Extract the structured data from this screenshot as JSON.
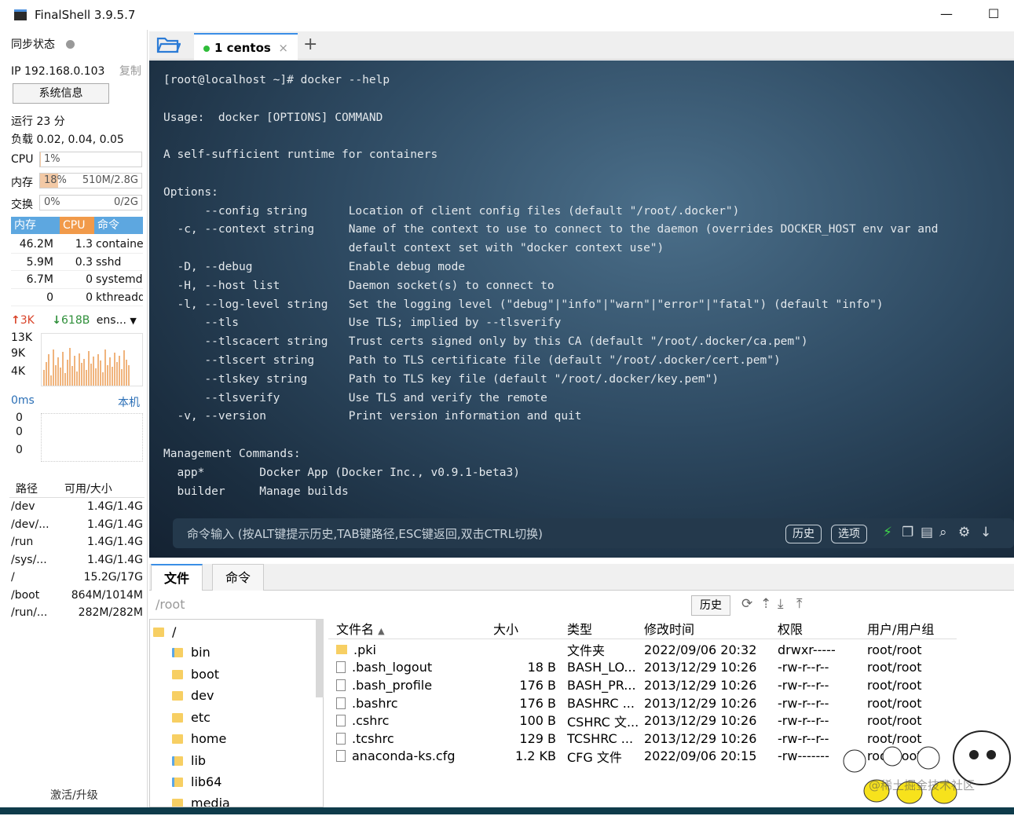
{
  "window": {
    "title": "FinalShell 3.9.5.7",
    "min": "—",
    "max": "☐"
  },
  "sidebar": {
    "sync_label": "同步状态",
    "ip": "IP 192.168.0.103",
    "copy": "复制",
    "sysinfo_btn": "系统信息",
    "uptime": "运行 23 分",
    "load": "负载 0.02, 0.04, 0.05",
    "cpu": {
      "label": "CPU",
      "pct": "1%",
      "fraction": 0.01,
      "amount": ""
    },
    "mem": {
      "label": "内存",
      "pct": "18%",
      "fraction": 0.18,
      "amount": "510M/2.8G"
    },
    "swap": {
      "label": "交换",
      "pct": "0%",
      "fraction": 0.0,
      "amount": "0/2G"
    },
    "proc_headers": [
      "内存",
      "CPU",
      "命令"
    ],
    "processes": [
      {
        "mem": "46.2M",
        "cpu": "1.3",
        "cmd": "containe"
      },
      {
        "mem": "5.9M",
        "cpu": "0.3",
        "cmd": "sshd"
      },
      {
        "mem": "6.7M",
        "cpu": "0",
        "cmd": "systemd"
      },
      {
        "mem": "0",
        "cpu": "0",
        "cmd": "kthreadd"
      }
    ],
    "net_up": "3K",
    "net_down": "618B",
    "net_iface": "ens...",
    "net_scale": [
      "13K",
      "9K",
      "4K"
    ],
    "ping_label": "0ms",
    "ping_host": "本机",
    "ping_values": [
      "0",
      "0",
      "0"
    ],
    "disk_headers": [
      "路径",
      "可用/大小"
    ],
    "disks": [
      {
        "path": "/dev",
        "size": "1.4G/1.4G"
      },
      {
        "path": "/dev/...",
        "size": "1.4G/1.4G"
      },
      {
        "path": "/run",
        "size": "1.4G/1.4G"
      },
      {
        "path": "/sys/...",
        "size": "1.4G/1.4G"
      },
      {
        "path": "/",
        "size": "15.2G/17G"
      },
      {
        "path": "/boot",
        "size": "864M/1014M"
      },
      {
        "path": "/run/...",
        "size": "282M/282M"
      }
    ],
    "activate": "激活/升级"
  },
  "tabs": {
    "session_number": "1",
    "session_name": "centos",
    "close": "×",
    "add": "+"
  },
  "terminal": {
    "lines": [
      "[root@localhost ~]# docker --help",
      "",
      "Usage:  docker [OPTIONS] COMMAND",
      "",
      "A self-sufficient runtime for containers",
      "",
      "Options:",
      "      --config string      Location of client config files (default \"/root/.docker\")",
      "  -c, --context string     Name of the context to use to connect to the daemon (overrides DOCKER_HOST env var and",
      "                           default context set with \"docker context use\")",
      "  -D, --debug              Enable debug mode",
      "  -H, --host list          Daemon socket(s) to connect to",
      "  -l, --log-level string   Set the logging level (\"debug\"|\"info\"|\"warn\"|\"error\"|\"fatal\") (default \"info\")",
      "      --tls                Use TLS; implied by --tlsverify",
      "      --tlscacert string   Trust certs signed only by this CA (default \"/root/.docker/ca.pem\")",
      "      --tlscert string     Path to TLS certificate file (default \"/root/.docker/cert.pem\")",
      "      --tlskey string      Path to TLS key file (default \"/root/.docker/key.pem\")",
      "      --tlsverify          Use TLS and verify the remote",
      "  -v, --version            Print version information and quit",
      "",
      "Management Commands:",
      "  app*        Docker App (Docker Inc., v0.9.1-beta3)",
      "  builder     Manage builds"
    ],
    "input_placeholder": "命令输入 (按ALT键提示历史,TAB键路径,ESC键返回,双击CTRL切换)",
    "history_btn": "历史",
    "options_btn": "选项"
  },
  "files": {
    "tabs": [
      "文件",
      "命令"
    ],
    "path": "/root",
    "history_btn": "历史",
    "tree_root": "/",
    "tree": [
      "bin",
      "boot",
      "dev",
      "etc",
      "home",
      "lib",
      "lib64",
      "media"
    ],
    "headers": [
      "文件名",
      "大小",
      "类型",
      "修改时间",
      "权限",
      "用户/用户组"
    ],
    "rows": [
      {
        "name": ".pki",
        "size": "",
        "type": "文件夹",
        "mtime": "2022/09/06 20:32",
        "perm": "drwxr-----",
        "owner": "root/root",
        "folder": true
      },
      {
        "name": ".bash_logout",
        "size": "18 B",
        "type": "BASH_LO...",
        "mtime": "2013/12/29 10:26",
        "perm": "-rw-r--r--",
        "owner": "root/root"
      },
      {
        "name": ".bash_profile",
        "size": "176 B",
        "type": "BASH_PR...",
        "mtime": "2013/12/29 10:26",
        "perm": "-rw-r--r--",
        "owner": "root/root"
      },
      {
        "name": ".bashrc",
        "size": "176 B",
        "type": "BASHRC ...",
        "mtime": "2013/12/29 10:26",
        "perm": "-rw-r--r--",
        "owner": "root/root"
      },
      {
        "name": ".cshrc",
        "size": "100 B",
        "type": "CSHRC 文...",
        "mtime": "2013/12/29 10:26",
        "perm": "-rw-r--r--",
        "owner": "root/root"
      },
      {
        "name": ".tcshrc",
        "size": "129 B",
        "type": "TCSHRC ...",
        "mtime": "2013/12/29 10:26",
        "perm": "-rw-r--r--",
        "owner": "root/root"
      },
      {
        "name": "anaconda-ks.cfg",
        "size": "1.2 KB",
        "type": "CFG 文件",
        "mtime": "2022/09/06 20:15",
        "perm": "-rw-------",
        "owner": "root/root"
      }
    ]
  },
  "watermark": "@稀土掘金技术社区",
  "colors": {
    "accent": "#3a8ee6",
    "connected": "#2fbd3a",
    "proc_header": "#5da7e0",
    "cpu_header": "#f19a4a"
  }
}
